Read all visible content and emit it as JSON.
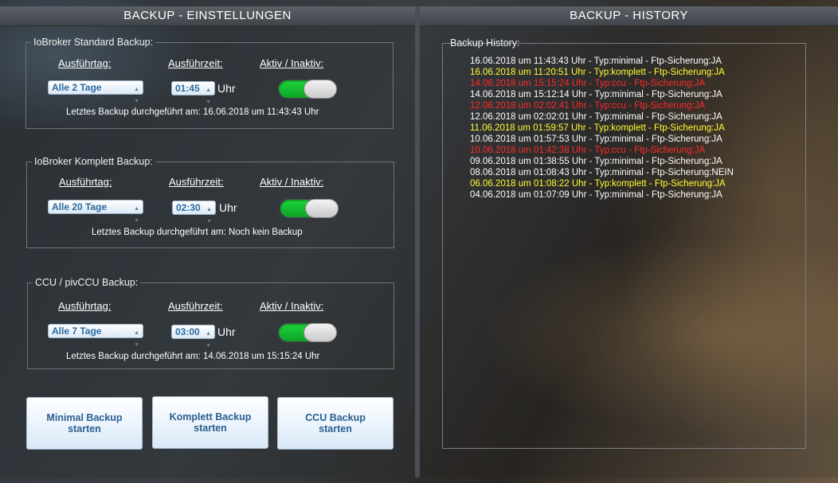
{
  "left": {
    "header": "BACKUP - EINSTELLUNGEN",
    "groups": [
      {
        "legend": "IoBroker Standard Backup:",
        "col_day": "Ausführtag:",
        "col_time": "Ausführzeit:",
        "col_active": "Aktiv / Inaktiv:",
        "day": "Alle 2 Tage",
        "time": "01:45",
        "unit": "Uhr",
        "active": true,
        "last_run": "Letztes Backup durchgeführt am: 16.06.2018 um 11:43:43 Uhr"
      },
      {
        "legend": "IoBroker Komplett Backup:",
        "col_day": "Ausführtag:",
        "col_time": "Ausführzeit:",
        "col_active": "Aktiv / Inaktiv:",
        "day": "Alle 20 Tage",
        "time": "02:30",
        "unit": "Uhr",
        "active": true,
        "last_run": "Letztes Backup durchgeführt am: Noch kein Backup"
      },
      {
        "legend": "CCU / pivCCU Backup:",
        "col_day": "Ausführtag:",
        "col_time": "Ausführzeit:",
        "col_active": "Aktiv / Inaktiv:",
        "day": "Alle 7 Tage",
        "time": "03:00",
        "unit": "Uhr",
        "active": true,
        "last_run": "Letztes Backup durchgeführt am: 14.06.2018 um 15:15:24 Uhr"
      }
    ],
    "buttons": {
      "minimal": "Minimal Backup\nstarten",
      "komplett": "Komplett Backup\nstarten",
      "ccu": "CCU Backup\nstarten"
    }
  },
  "right": {
    "header": "BACKUP - HISTORY",
    "legend": "Backup History:",
    "entries": [
      {
        "text": "16.06.2018 um 11:43:43 Uhr - Typ:minimal - Ftp-Sicherung:JA",
        "color": "#ffffff"
      },
      {
        "text": "16.06.2018 um 11:20:51 Uhr - Typ:komplett - Ftp-Sicherung:JA",
        "color": "#ffff33"
      },
      {
        "text": "14.06.2018 um 15:15:24 Uhr - Typ:ccu - Ftp-Sicherung:JA",
        "color": "#ff2a2a"
      },
      {
        "text": "14.06.2018 um 15:12:14 Uhr - Typ:minimal - Ftp-Sicherung:JA",
        "color": "#ffffff"
      },
      {
        "text": "12.06.2018 um 02:02:41 Uhr - Typ:ccu - Ftp-Sicherung:JA",
        "color": "#ff2a2a"
      },
      {
        "text": "12.06.2018 um 02:02:01 Uhr - Typ:minimal - Ftp-Sicherung:JA",
        "color": "#ffffff"
      },
      {
        "text": "11.06.2018 um 01:59:57 Uhr - Typ:komplett - Ftp-Sicherung:JA",
        "color": "#ffff33"
      },
      {
        "text": "10.06.2018 um 01:57:53 Uhr - Typ:minimal - Ftp-Sicherung:JA",
        "color": "#ffffff"
      },
      {
        "text": "10.06.2018 um 01:42:38 Uhr - Typ:ccu - Ftp-Sicherung:JA",
        "color": "#ff2a2a"
      },
      {
        "text": "09.06.2018 um 01:38:55 Uhr - Typ:minimal - Ftp-Sicherung:JA",
        "color": "#ffffff"
      },
      {
        "text": "08.06.2018 um 01:08:43 Uhr - Typ:minimal - Ftp-Sicherung:NEIN",
        "color": "#ffffff"
      },
      {
        "text": "06.06.2018 um 01:08:22 Uhr - Typ:komplett - Ftp-Sicherung:JA",
        "color": "#ffff33"
      },
      {
        "text": "04.06.2018 um 01:07:09 Uhr - Typ:minimal - Ftp-Sicherung:JA",
        "color": "#ffffff"
      }
    ]
  }
}
